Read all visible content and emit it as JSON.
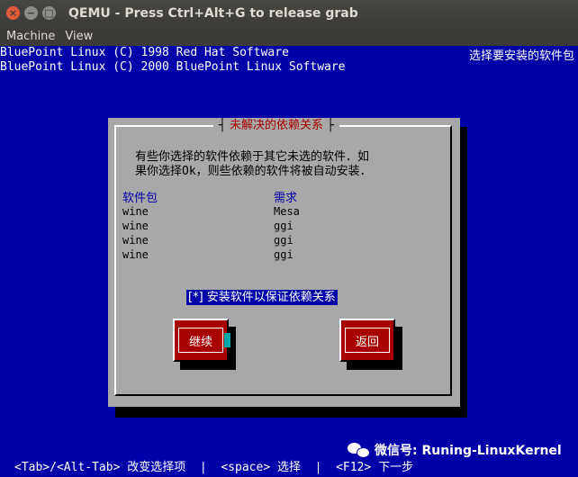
{
  "window": {
    "title": "QEMU - Press Ctrl+Alt+G to release grab"
  },
  "menu": {
    "items": [
      "Machine",
      "View"
    ]
  },
  "console": {
    "line1": "BluePoint Linux (C) 1998 Red Hat Software",
    "line2": "BluePoint Linux (C) 2000 BluePoint Linux Software",
    "right_title": "选择要安装的软件包"
  },
  "dialog": {
    "title": "未解决的依赖关系",
    "message_line1": "有些你选择的软件依赖于其它未选的软件．如",
    "message_line2": "果你选择Ok，则些依赖的软件将被自动安装．",
    "columns": [
      "软件包",
      "需求"
    ],
    "rows": [
      [
        "wine",
        "Mesa"
      ],
      [
        "wine",
        "ggi"
      ],
      [
        "wine",
        "ggi"
      ],
      [
        "wine",
        "ggi"
      ]
    ],
    "checkbox_label": "[*] 安装软件以保证依赖关系",
    "continue_label": "继续",
    "back_label": "返回"
  },
  "footer": {
    "help": "<Tab>/<Alt-Tab> 改变选择项  |  <space> 选择  |  <F12> 下一步"
  },
  "watermark": {
    "text": "微信号: Runing-LinuxKernel"
  },
  "colors": {
    "background": "#0000a8",
    "dialog": "#a8a8a8",
    "button": "#a80000",
    "title": "#a80000"
  }
}
